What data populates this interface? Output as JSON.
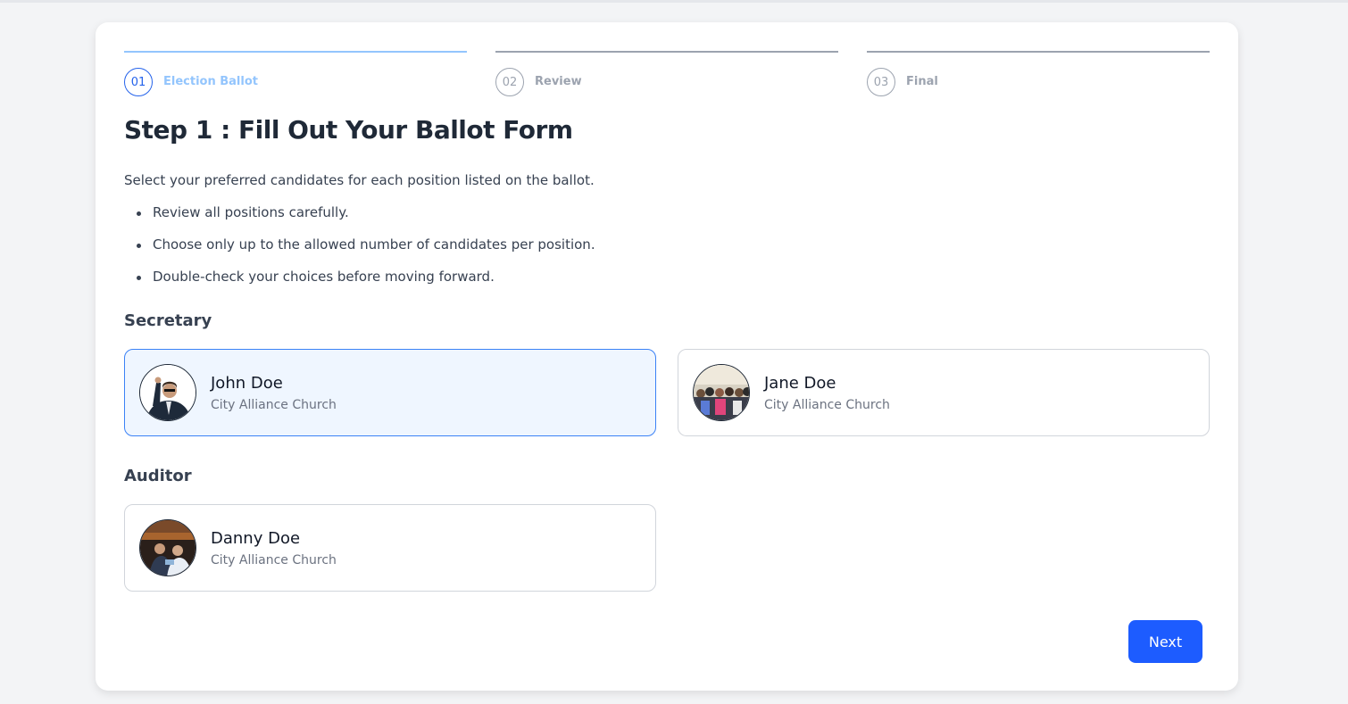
{
  "stepper": {
    "steps": [
      {
        "number": "01",
        "label": "Election Ballot",
        "active": true
      },
      {
        "number": "02",
        "label": "Review",
        "active": false
      },
      {
        "number": "03",
        "label": "Final",
        "active": false
      }
    ]
  },
  "page_title": "Step 1 : Fill Out Your Ballot Form",
  "intro": "Select your preferred candidates for each position listed on the ballot.",
  "rules": [
    "Review all positions carefully.",
    "Choose only up to the allowed number of candidates per position.",
    "Double-check your choices before moving forward."
  ],
  "positions": [
    {
      "title": "Secretary",
      "candidates": [
        {
          "name": "John Doe",
          "organization": "City Alliance Church",
          "selected": true,
          "photo": "man-in-suit-waving-photo"
        },
        {
          "name": "Jane Doe",
          "organization": "City Alliance Church",
          "selected": false,
          "photo": "crowd-photo"
        }
      ]
    },
    {
      "title": "Auditor",
      "candidates": [
        {
          "name": "Danny Doe",
          "organization": "City Alliance Church",
          "selected": false,
          "photo": "two-people-indoors-photo"
        }
      ]
    }
  ],
  "next_button": "Next",
  "colors": {
    "accent": "#1d5cff",
    "active_step": "#2563eb",
    "active_step_light": "#93c5fd",
    "selected_border": "#3b82f6",
    "selected_bg": "#eff6ff"
  }
}
